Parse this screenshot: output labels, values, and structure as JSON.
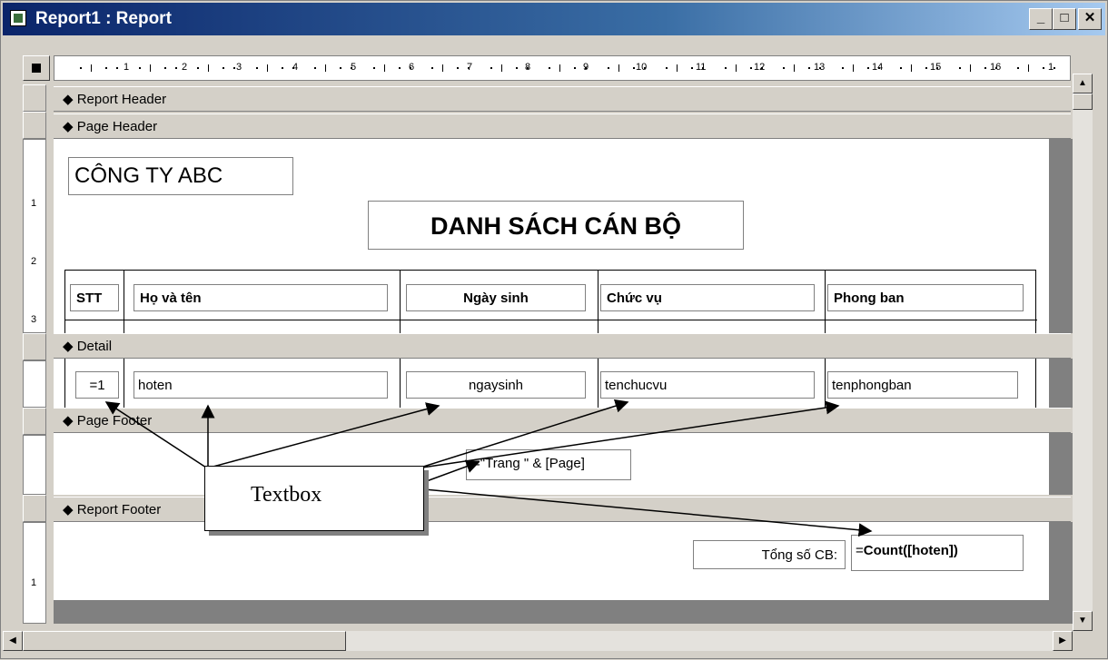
{
  "window": {
    "title": "Report1 : Report",
    "buttons": {
      "minimize": "_",
      "maximize": "□",
      "close": "✕"
    }
  },
  "ruler": {
    "numbers": [
      "1",
      "2",
      "3",
      "4",
      "5",
      "6",
      "7",
      "8",
      "9",
      "10",
      "11",
      "12",
      "13",
      "14",
      "15",
      "16",
      "1"
    ]
  },
  "vruler": {
    "page_header_nums": [
      "1",
      "2",
      "3"
    ],
    "report_footer_nums": [
      "1"
    ]
  },
  "sections": {
    "report_header": "Report Header",
    "page_header": "Page Header",
    "detail": "Detail",
    "page_footer": "Page Footer",
    "report_footer": "Report Footer"
  },
  "page_header": {
    "company": "CÔNG TY ABC",
    "title": "DANH SÁCH CÁN BỘ",
    "columns": [
      "STT",
      "Họ và tên",
      "Ngày sinh",
      "Chức vụ",
      "Phong ban"
    ]
  },
  "detail": {
    "fields": [
      "=1",
      "hoten",
      "ngaysinh",
      "tenchucvu",
      "tenphongban"
    ]
  },
  "page_footer": {
    "page_expr": "=\"Trang \" & [Page]"
  },
  "report_footer": {
    "label": "Tổng số CB:",
    "count_prefix": "=",
    "count_expr": "Count([hoten])"
  },
  "annotation": {
    "callout": "Textbox"
  },
  "colors": {
    "titlebar_start": "#0a246a",
    "titlebar_end": "#a6caf0",
    "face": "#d4d0c8"
  }
}
